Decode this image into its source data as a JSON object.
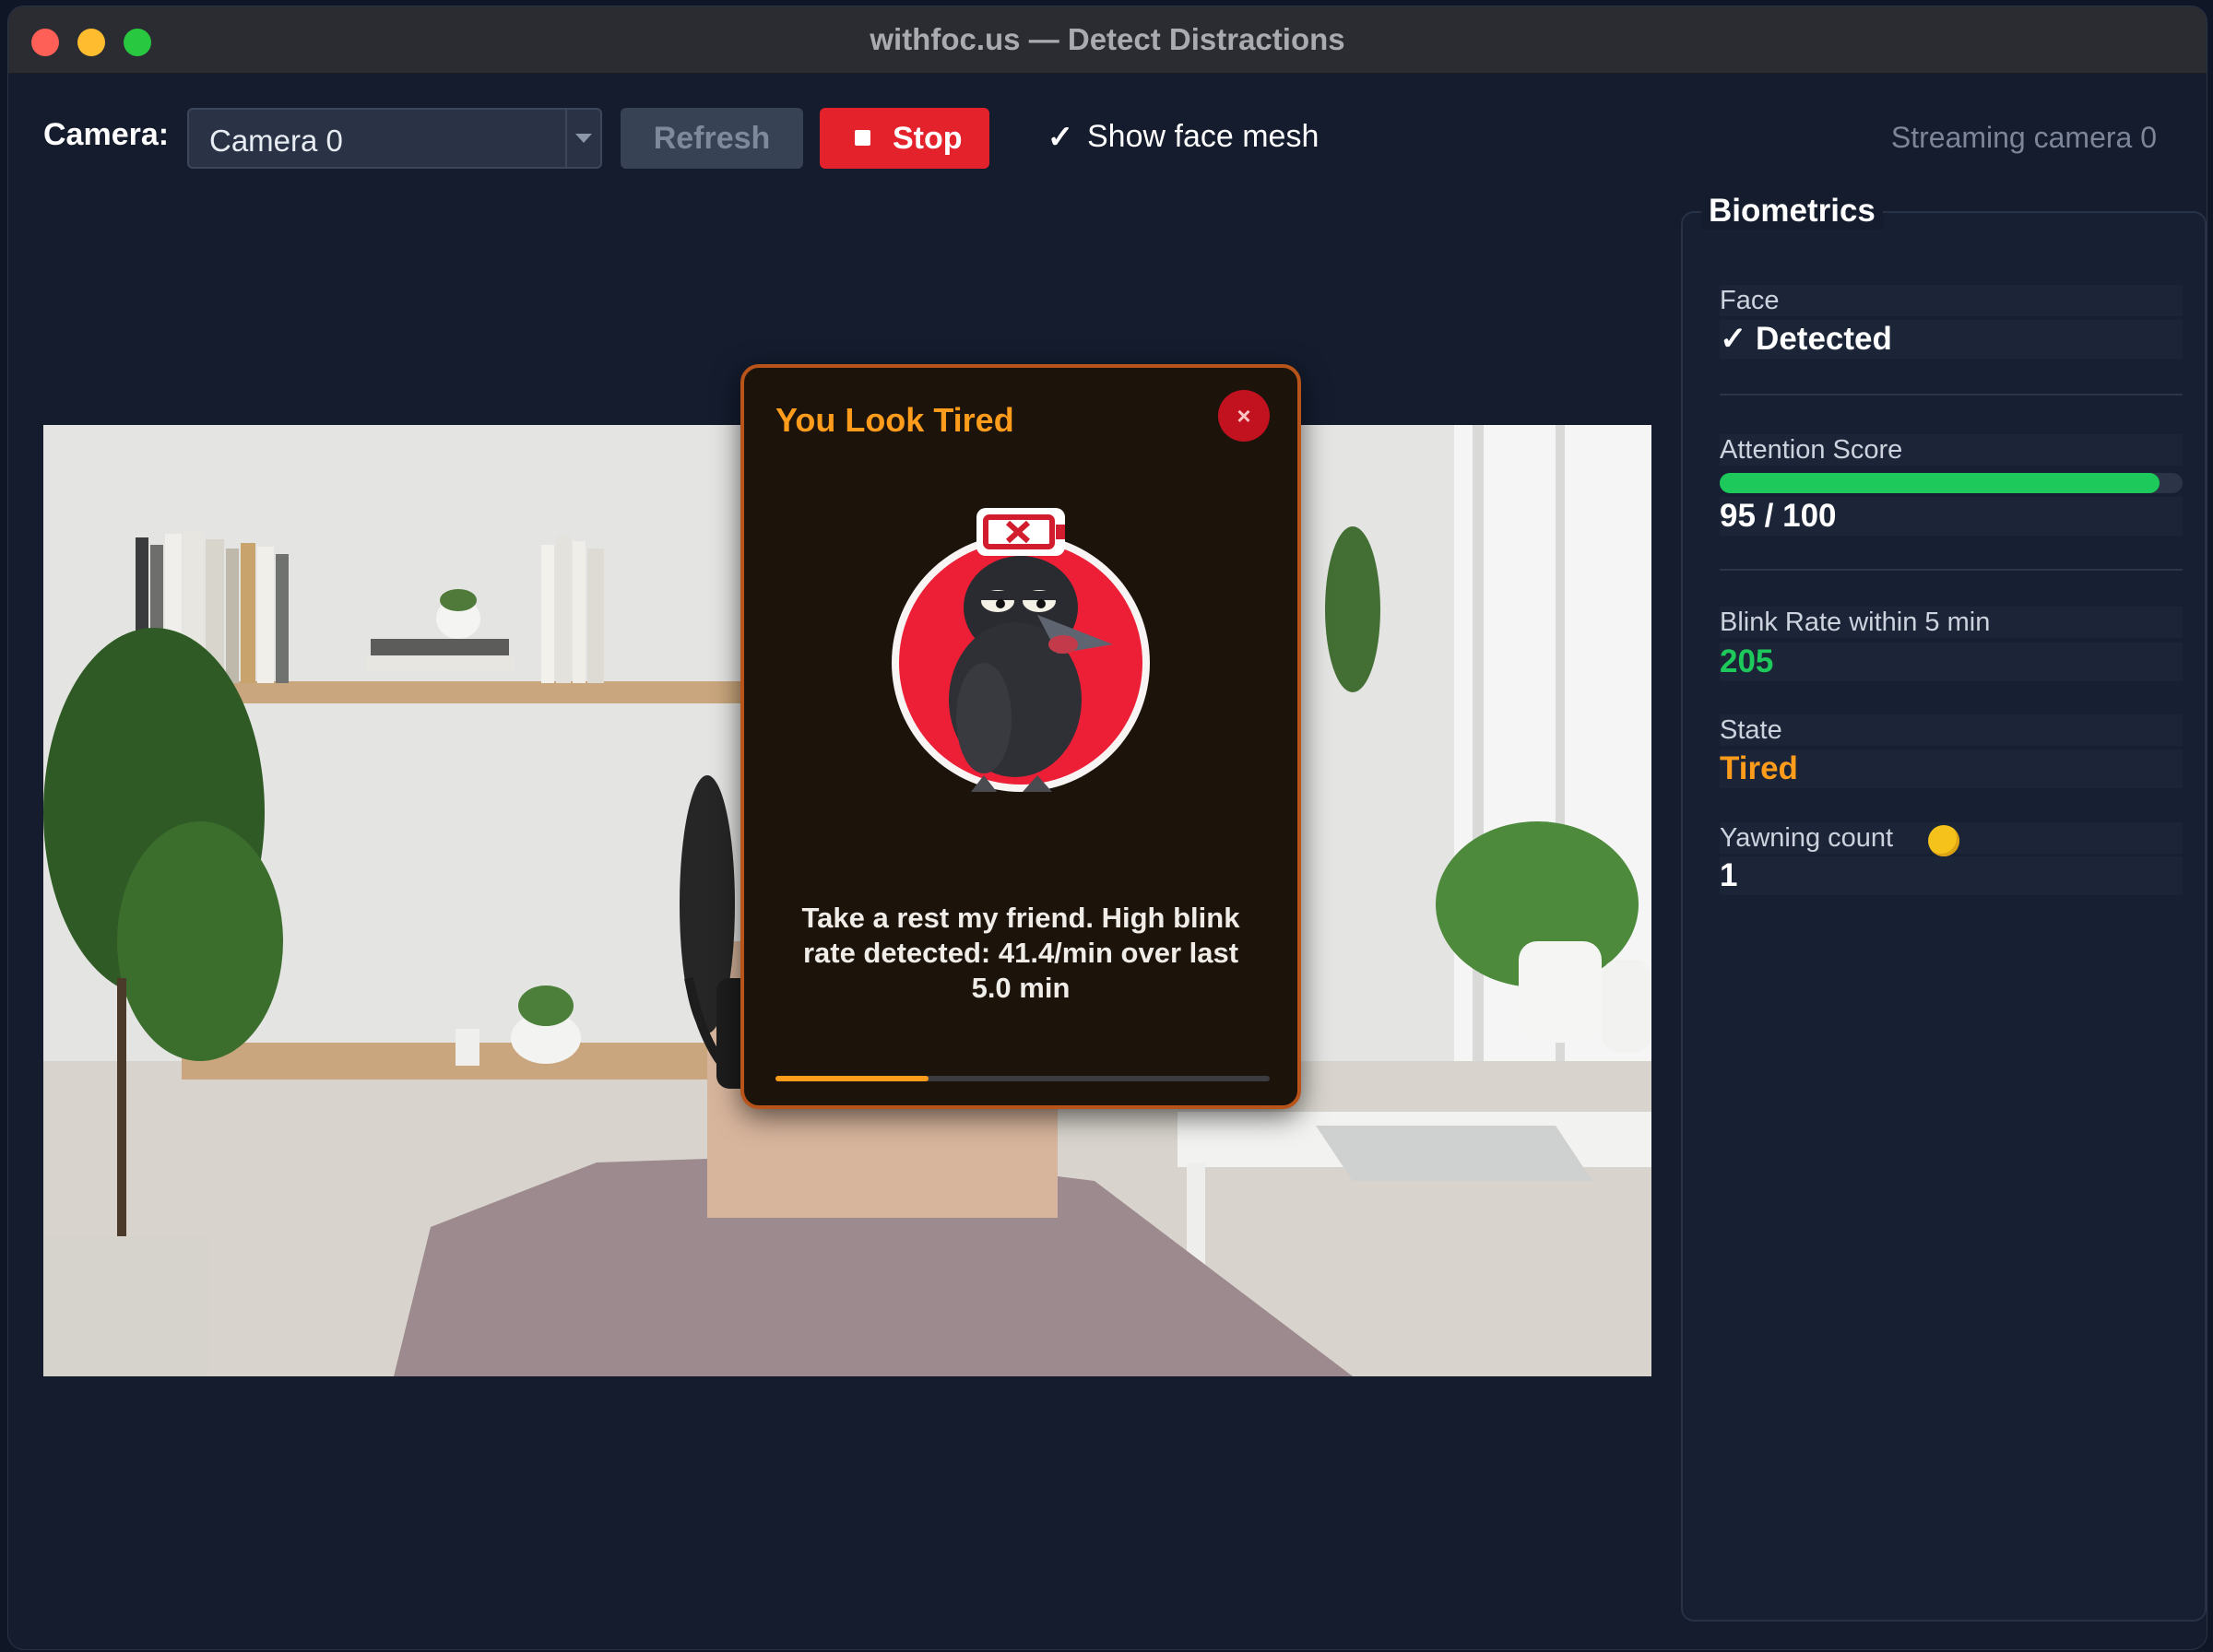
{
  "window": {
    "title": "withfoc.us — Detect Distractions"
  },
  "toolbar": {
    "camera_label": "Camera:",
    "camera_selected": "Camera 0",
    "refresh_label": "Refresh",
    "stop_label": "Stop",
    "show_face_mesh_checked": true,
    "show_face_mesh_label": "Show face mesh",
    "status_text": "Streaming camera 0"
  },
  "alert": {
    "title": "You Look Tired",
    "close_symbol": "×",
    "message": "Take a rest my friend. High blink rate detected: 41.4/min over last 5.0 min",
    "progress_fraction": 0.31,
    "accent_color": "#ff9c1c",
    "badge_icon_text": "×"
  },
  "biometrics": {
    "title": "Biometrics",
    "face": {
      "label": "Face",
      "value": "✓ Detected",
      "color": "#ffffff"
    },
    "attention": {
      "label": "Attention Score",
      "value": "95 / 100",
      "score": 95,
      "max": 100,
      "bar_color": "#1dc95a"
    },
    "blink": {
      "label": "Blink Rate within 5 min",
      "value": "205",
      "color": "#1dc95a"
    },
    "state": {
      "label": "State",
      "value": "Tired",
      "color": "#ff9c1c"
    },
    "yawning": {
      "label": "Yawning count",
      "icon": "yawning-face-emoji",
      "value": "1"
    }
  }
}
